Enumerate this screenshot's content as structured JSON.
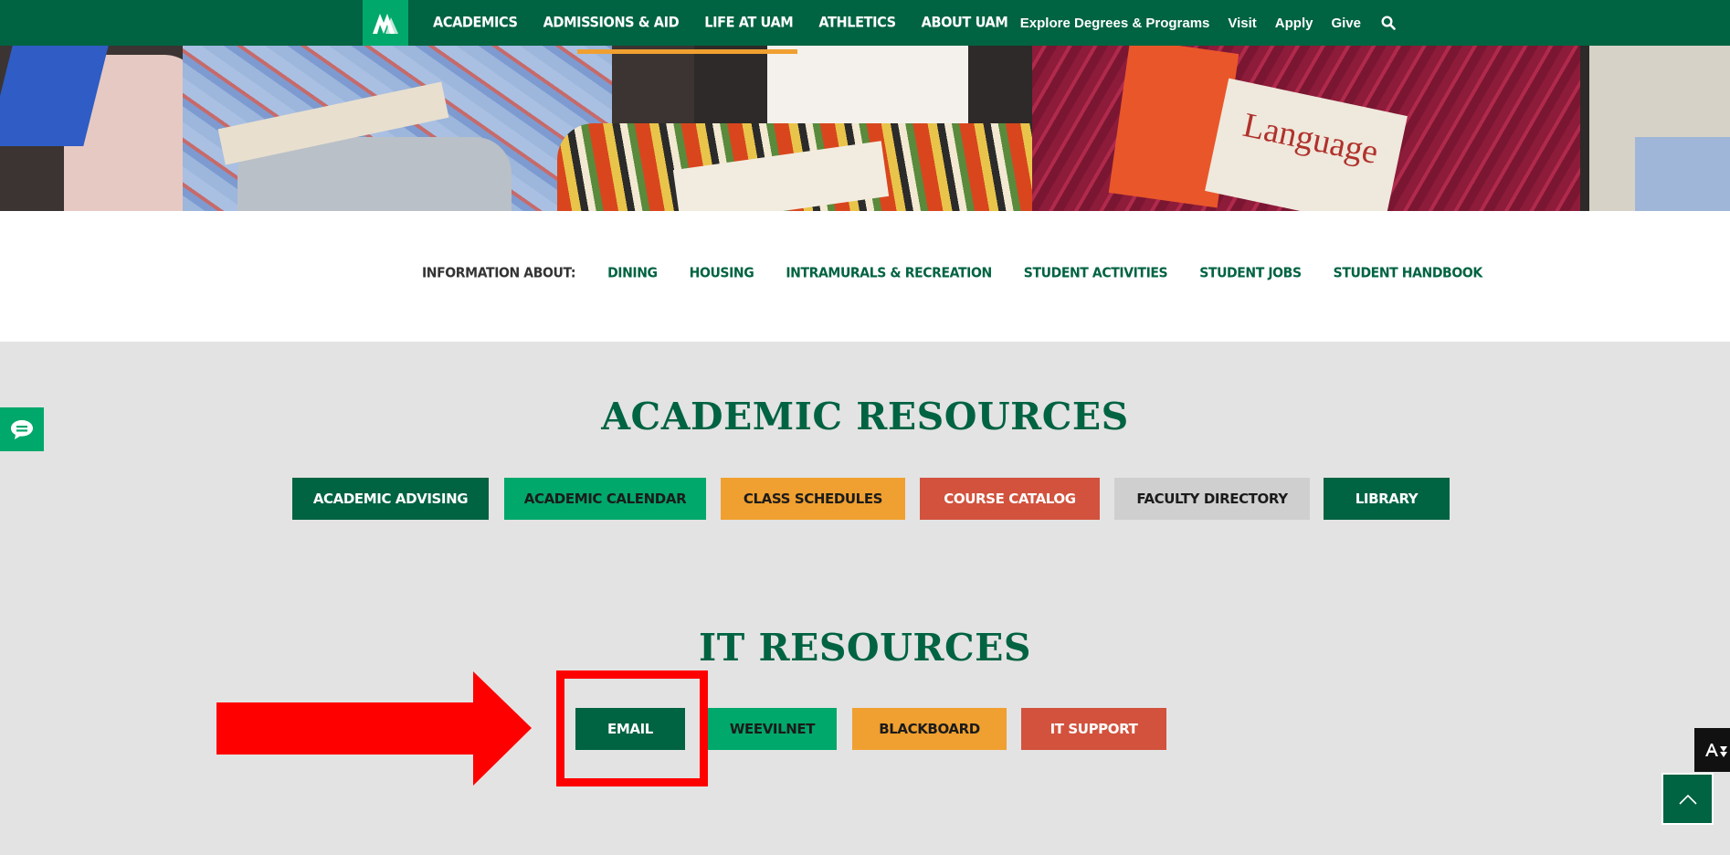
{
  "nav": {
    "main": [
      "ACADEMICS",
      "ADMISSIONS & AID",
      "LIFE AT UAM",
      "ATHLETICS",
      "ABOUT UAM"
    ],
    "utility": [
      "Explore Degrees & Programs",
      "Visit",
      "Apply",
      "Give"
    ],
    "search_icon": "search-icon"
  },
  "hero": {
    "magazine_title": "Language"
  },
  "info": {
    "label": "INFORMATION ABOUT:",
    "links": [
      "DINING",
      "HOUSING",
      "INTRAMURALS & RECREATION",
      "STUDENT ACTIVITIES",
      "STUDENT JOBS",
      "STUDENT HANDBOOK"
    ]
  },
  "academic": {
    "title": "ACADEMIC RESOURCES",
    "buttons": [
      "ACADEMIC ADVISING",
      "ACADEMIC CALENDAR",
      "CLASS SCHEDULES",
      "COURSE CATALOG",
      "FACULTY DIRECTORY",
      "LIBRARY"
    ]
  },
  "it": {
    "title": "IT RESOURCES",
    "buttons": [
      "EMAIL",
      "WEEVILNET",
      "BLACKBOARD",
      "IT SUPPORT"
    ]
  },
  "colors": {
    "brand_green": "#006341",
    "accent_green": "#00a86b",
    "orange": "#f0a030",
    "red": "#d2523d",
    "annotation_red": "#ff0000"
  }
}
